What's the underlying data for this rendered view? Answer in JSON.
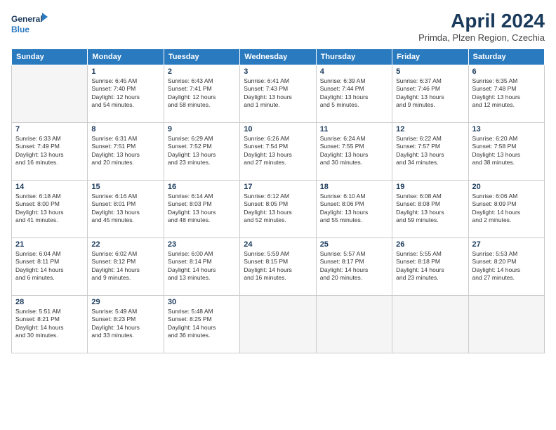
{
  "logo": {
    "line1": "General",
    "line2": "Blue"
  },
  "title": "April 2024",
  "subtitle": "Primda, Plzen Region, Czechia",
  "weekdays": [
    "Sunday",
    "Monday",
    "Tuesday",
    "Wednesday",
    "Thursday",
    "Friday",
    "Saturday"
  ],
  "weeks": [
    [
      {
        "day": "",
        "info": ""
      },
      {
        "day": "1",
        "info": "Sunrise: 6:45 AM\nSunset: 7:40 PM\nDaylight: 12 hours\nand 54 minutes."
      },
      {
        "day": "2",
        "info": "Sunrise: 6:43 AM\nSunset: 7:41 PM\nDaylight: 12 hours\nand 58 minutes."
      },
      {
        "day": "3",
        "info": "Sunrise: 6:41 AM\nSunset: 7:43 PM\nDaylight: 13 hours\nand 1 minute."
      },
      {
        "day": "4",
        "info": "Sunrise: 6:39 AM\nSunset: 7:44 PM\nDaylight: 13 hours\nand 5 minutes."
      },
      {
        "day": "5",
        "info": "Sunrise: 6:37 AM\nSunset: 7:46 PM\nDaylight: 13 hours\nand 9 minutes."
      },
      {
        "day": "6",
        "info": "Sunrise: 6:35 AM\nSunset: 7:48 PM\nDaylight: 13 hours\nand 12 minutes."
      }
    ],
    [
      {
        "day": "7",
        "info": "Sunrise: 6:33 AM\nSunset: 7:49 PM\nDaylight: 13 hours\nand 16 minutes."
      },
      {
        "day": "8",
        "info": "Sunrise: 6:31 AM\nSunset: 7:51 PM\nDaylight: 13 hours\nand 20 minutes."
      },
      {
        "day": "9",
        "info": "Sunrise: 6:29 AM\nSunset: 7:52 PM\nDaylight: 13 hours\nand 23 minutes."
      },
      {
        "day": "10",
        "info": "Sunrise: 6:26 AM\nSunset: 7:54 PM\nDaylight: 13 hours\nand 27 minutes."
      },
      {
        "day": "11",
        "info": "Sunrise: 6:24 AM\nSunset: 7:55 PM\nDaylight: 13 hours\nand 30 minutes."
      },
      {
        "day": "12",
        "info": "Sunrise: 6:22 AM\nSunset: 7:57 PM\nDaylight: 13 hours\nand 34 minutes."
      },
      {
        "day": "13",
        "info": "Sunrise: 6:20 AM\nSunset: 7:58 PM\nDaylight: 13 hours\nand 38 minutes."
      }
    ],
    [
      {
        "day": "14",
        "info": "Sunrise: 6:18 AM\nSunset: 8:00 PM\nDaylight: 13 hours\nand 41 minutes."
      },
      {
        "day": "15",
        "info": "Sunrise: 6:16 AM\nSunset: 8:01 PM\nDaylight: 13 hours\nand 45 minutes."
      },
      {
        "day": "16",
        "info": "Sunrise: 6:14 AM\nSunset: 8:03 PM\nDaylight: 13 hours\nand 48 minutes."
      },
      {
        "day": "17",
        "info": "Sunrise: 6:12 AM\nSunset: 8:05 PM\nDaylight: 13 hours\nand 52 minutes."
      },
      {
        "day": "18",
        "info": "Sunrise: 6:10 AM\nSunset: 8:06 PM\nDaylight: 13 hours\nand 55 minutes."
      },
      {
        "day": "19",
        "info": "Sunrise: 6:08 AM\nSunset: 8:08 PM\nDaylight: 13 hours\nand 59 minutes."
      },
      {
        "day": "20",
        "info": "Sunrise: 6:06 AM\nSunset: 8:09 PM\nDaylight: 14 hours\nand 2 minutes."
      }
    ],
    [
      {
        "day": "21",
        "info": "Sunrise: 6:04 AM\nSunset: 8:11 PM\nDaylight: 14 hours\nand 6 minutes."
      },
      {
        "day": "22",
        "info": "Sunrise: 6:02 AM\nSunset: 8:12 PM\nDaylight: 14 hours\nand 9 minutes."
      },
      {
        "day": "23",
        "info": "Sunrise: 6:00 AM\nSunset: 8:14 PM\nDaylight: 14 hours\nand 13 minutes."
      },
      {
        "day": "24",
        "info": "Sunrise: 5:59 AM\nSunset: 8:15 PM\nDaylight: 14 hours\nand 16 minutes."
      },
      {
        "day": "25",
        "info": "Sunrise: 5:57 AM\nSunset: 8:17 PM\nDaylight: 14 hours\nand 20 minutes."
      },
      {
        "day": "26",
        "info": "Sunrise: 5:55 AM\nSunset: 8:18 PM\nDaylight: 14 hours\nand 23 minutes."
      },
      {
        "day": "27",
        "info": "Sunrise: 5:53 AM\nSunset: 8:20 PM\nDaylight: 14 hours\nand 27 minutes."
      }
    ],
    [
      {
        "day": "28",
        "info": "Sunrise: 5:51 AM\nSunset: 8:21 PM\nDaylight: 14 hours\nand 30 minutes."
      },
      {
        "day": "29",
        "info": "Sunrise: 5:49 AM\nSunset: 8:23 PM\nDaylight: 14 hours\nand 33 minutes."
      },
      {
        "day": "30",
        "info": "Sunrise: 5:48 AM\nSunset: 8:25 PM\nDaylight: 14 hours\nand 36 minutes."
      },
      {
        "day": "",
        "info": ""
      },
      {
        "day": "",
        "info": ""
      },
      {
        "day": "",
        "info": ""
      },
      {
        "day": "",
        "info": ""
      }
    ]
  ]
}
